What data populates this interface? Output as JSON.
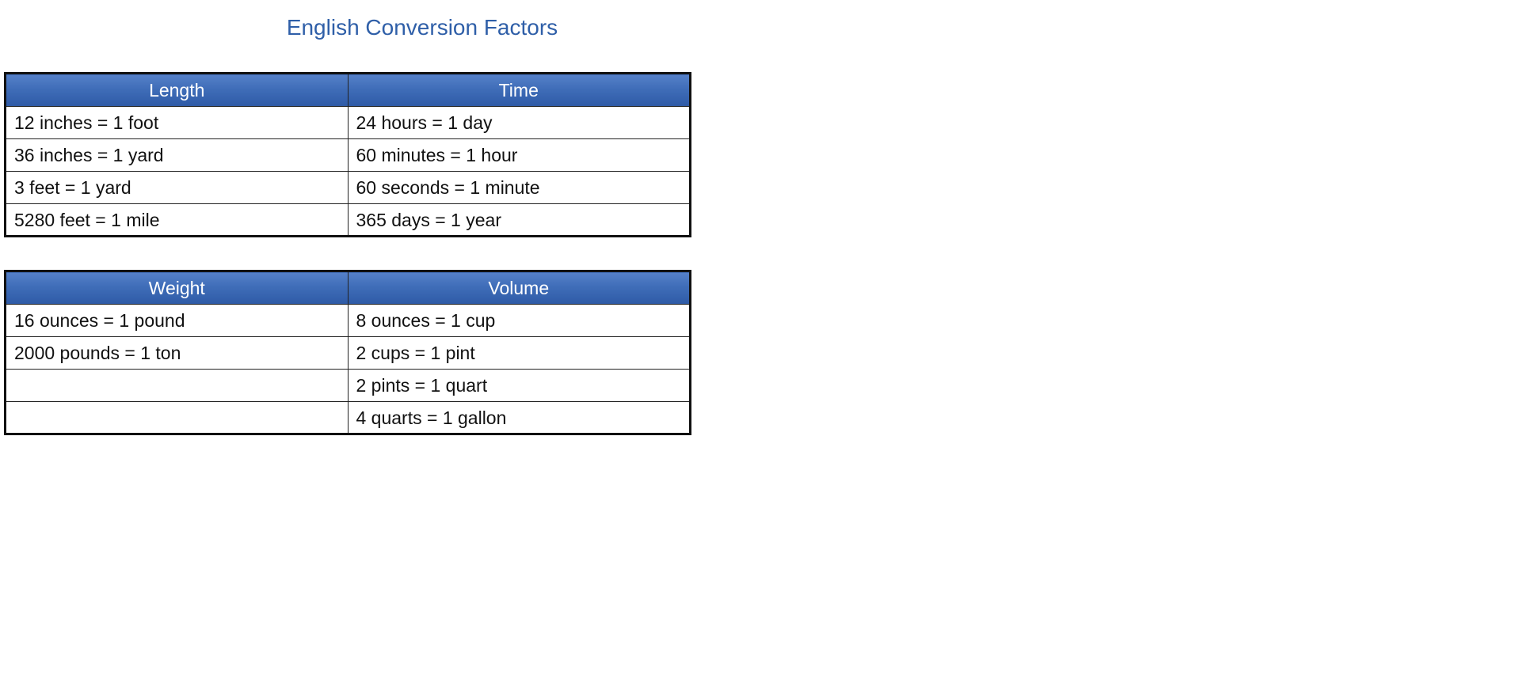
{
  "page": {
    "title": "English Conversion Factors"
  },
  "tables": [
    {
      "headers": [
        "Length",
        "Time"
      ],
      "rows": [
        [
          "12 inches = 1 foot",
          "24 hours = 1 day"
        ],
        [
          "36 inches = 1 yard",
          "60 minutes = 1 hour"
        ],
        [
          "3 feet = 1 yard",
          "60 seconds = 1 minute"
        ],
        [
          "5280 feet = 1 mile",
          "365 days = 1 year"
        ]
      ]
    },
    {
      "headers": [
        "Weight",
        "Volume"
      ],
      "rows": [
        [
          "16 ounces = 1 pound",
          "8 ounces = 1 cup"
        ],
        [
          "2000 pounds = 1 ton",
          "2 cups = 1 pint"
        ],
        [
          "",
          "2 pints = 1 quart"
        ],
        [
          "",
          "4 quarts = 1 gallon"
        ]
      ]
    }
  ],
  "colors": {
    "title": "#2f5fa8",
    "header_bg": "#3f6db8",
    "header_text": "#ffffff",
    "border": "#111111"
  }
}
